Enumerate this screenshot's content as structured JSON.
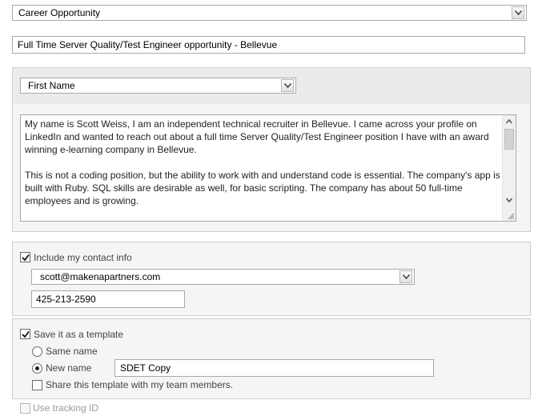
{
  "category_select": {
    "value": "Career Opportunity"
  },
  "subject": {
    "value": "Full Time Server Quality/Test Engineer opportunity - Bellevue"
  },
  "greeting_select": {
    "value": "First Name"
  },
  "message": {
    "paragraphs": [
      "My name is Scott Weiss, I am an independent technical recruiter in Bellevue.  I came across your profile on LinkedIn and wanted to reach out about a full time Server Quality/Test Engineer position I have with an award winning e-learning company in Bellevue.",
      "This is not a coding position, but the ability to work with and understand code is essential.  The company's app is built with Ruby.  SQL skills are desirable as well, for basic scripting. The company has about 50 full-time employees and is growing."
    ]
  },
  "contact": {
    "checkbox_label": "Include my contact info",
    "checked": true,
    "email_value": "scott@makenapartners.com",
    "phone_value": "425-213-2590"
  },
  "template": {
    "checkbox_label": "Save it as a template",
    "checked": true,
    "same_name_label": "Same name",
    "new_name_label": "New name",
    "selected": "new_name",
    "new_name_value": "SDET Copy",
    "share_label": "Share this template with my team members.",
    "share_checked": false
  },
  "tracking": {
    "label": "Use tracking ID",
    "checked": false,
    "disabled": true
  }
}
